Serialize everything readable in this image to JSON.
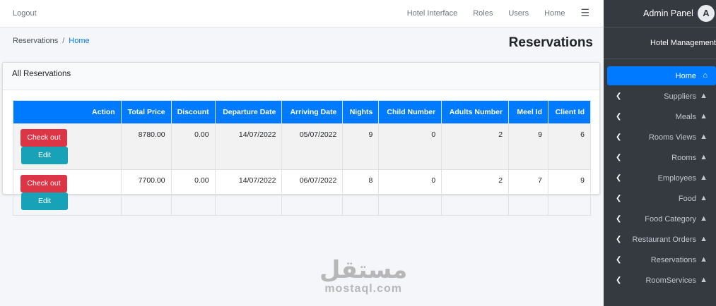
{
  "topbar": {
    "logout": "Logout",
    "nav": [
      "Hotel Interface",
      "Roles",
      "Users",
      "Home"
    ],
    "menu_icon": "hamburger-icon"
  },
  "breadcrumb": {
    "first": "Reservations",
    "separator": "/",
    "active": "Home"
  },
  "page": {
    "title": "Reservations"
  },
  "card": {
    "title": "All Reservations"
  },
  "table": {
    "headers": [
      "Action",
      "Total Price",
      "Discount",
      "Departure Date",
      "Arriving Date",
      "Nights",
      "Child Number",
      "Adults Number",
      "Meel Id",
      "Client Id"
    ],
    "rows": [
      {
        "total_price": "8780.00",
        "discount": "0.00",
        "departure": "14/07/2022",
        "arriving": "05/07/2022",
        "nights": "9",
        "child": "0",
        "adults": "2",
        "meel_id": "9",
        "client_id": "6"
      },
      {
        "total_price": "7700.00",
        "discount": "0.00",
        "departure": "14/07/2022",
        "arriving": "06/07/2022",
        "nights": "8",
        "child": "0",
        "adults": "2",
        "meel_id": "7",
        "client_id": "9"
      }
    ],
    "checkout_label": "Check out",
    "edit_label": "Edit"
  },
  "sidebar": {
    "brand": "Admin Panel",
    "brand_logo": "A",
    "user": "Hotel Management",
    "items": [
      {
        "label": "Home",
        "icon": "home-icon"
      },
      {
        "label": "Suppliers",
        "icon": "tree-icon"
      },
      {
        "label": "Meals",
        "icon": "tree-icon"
      },
      {
        "label": "Rooms Views",
        "icon": "tree-icon"
      },
      {
        "label": "Rooms",
        "icon": "tree-icon"
      },
      {
        "label": "Employees",
        "icon": "tree-icon"
      },
      {
        "label": "Food",
        "icon": "tree-icon"
      },
      {
        "label": "Food Category",
        "icon": "tree-icon"
      },
      {
        "label": "Restaurant Orders",
        "icon": "tree-icon"
      },
      {
        "label": "Reservations",
        "icon": "tree-icon"
      },
      {
        "label": "RoomServices",
        "icon": "tree-icon"
      }
    ]
  },
  "watermark": {
    "arabic": "مستقل",
    "latin": "mostaql.com"
  },
  "colors": {
    "primary": "#007bff",
    "danger": "#dc3545",
    "info": "#17a2b8",
    "sidebar": "#343a40"
  }
}
